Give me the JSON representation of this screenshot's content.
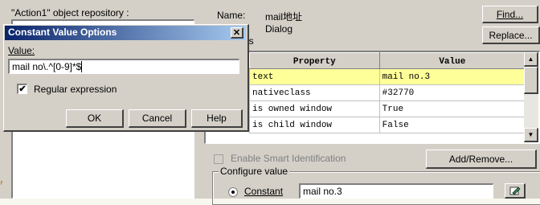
{
  "repo": {
    "title": "\"Action1\" object repository :",
    "name_label": "Name:",
    "name_value": "mail地址",
    "class_value": "Dialog",
    "properties_suffix": "es",
    "find_button": "Find...",
    "replace_button": "Replace...",
    "table": {
      "headers": [
        "Property",
        "Value"
      ],
      "rows": [
        {
          "property": "text",
          "value": "mail no.3"
        },
        {
          "property": "nativeclass",
          "value": "#32770"
        },
        {
          "property": "is owned window",
          "value": "True"
        },
        {
          "property": "is child window",
          "value": "False"
        }
      ]
    },
    "smart_id_label": "Enable Smart Identification",
    "add_remove_button": "Add/Remove...",
    "configure_group_label": "Configure value",
    "constant_radio_label": "Constant",
    "constant_value": "mail no.3"
  },
  "dialog": {
    "title": "Constant Value Options",
    "value_label": "Value:",
    "value_input": "mail no\\.^[0-9]*$",
    "regex_label": "Regular expression",
    "regex_checked": true,
    "ok_button": "OK",
    "cancel_button": "Cancel",
    "help_button": "Help"
  },
  "colors": {
    "selected_row": "#ffff99",
    "dialog_title_start": "#0a246a",
    "dialog_title_end": "#a6caf0",
    "slide_background": "#f7f7ef"
  }
}
